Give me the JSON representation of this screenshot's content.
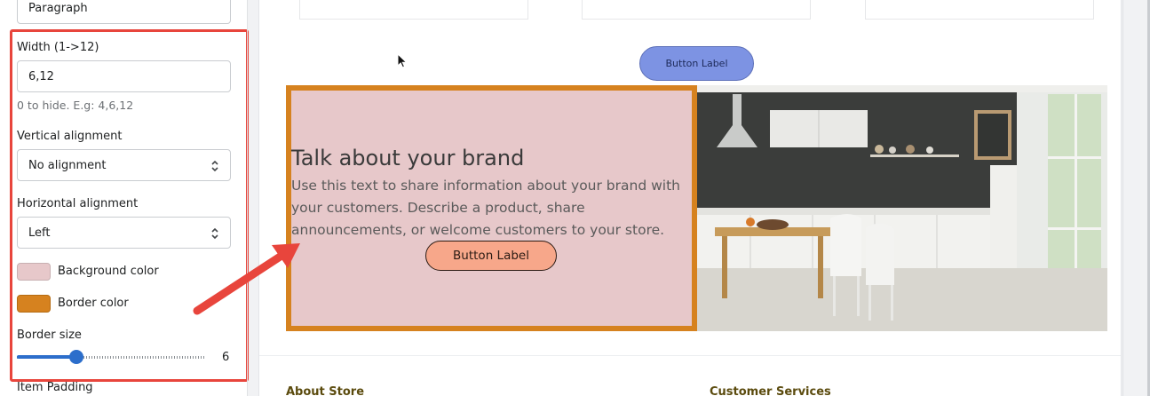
{
  "panel": {
    "paragraph_value": "Paragraph",
    "width_label": "Width (1->12)",
    "width_value": "6,12",
    "width_hint": "0 to hide. E.g: 4,6,12",
    "valign_label": "Vertical alignment",
    "valign_value": "No alignment",
    "halign_label": "Horizontal alignment",
    "halign_value": "Left",
    "bg_color_label": "Background color",
    "bg_color": "#e7c8ca",
    "border_color_label": "Border color",
    "border_color": "#d6821f",
    "border_size_label": "Border size",
    "border_size_value": "6",
    "border_size_fraction": 0.33,
    "item_padding_label": "Item Padding"
  },
  "preview": {
    "top_button_label": "Button Label",
    "brand_title": "Talk about your brand",
    "brand_text": "Use this text to share information about your brand with your customers. Describe a product, share announcements, or welcome customers to your store.",
    "brand_button_label": "Button Label",
    "footer_left": "About Store",
    "footer_right": "Customer Services"
  },
  "colors": {
    "annotation_red": "#e8453c",
    "accent_blue": "#2c6ecb",
    "top_button_bg": "#7d93e3",
    "brand_button_bg": "#f7a78a"
  },
  "icons": [
    "select-chevron-icon",
    "cursor-icon",
    "annotation-arrow-icon"
  ]
}
